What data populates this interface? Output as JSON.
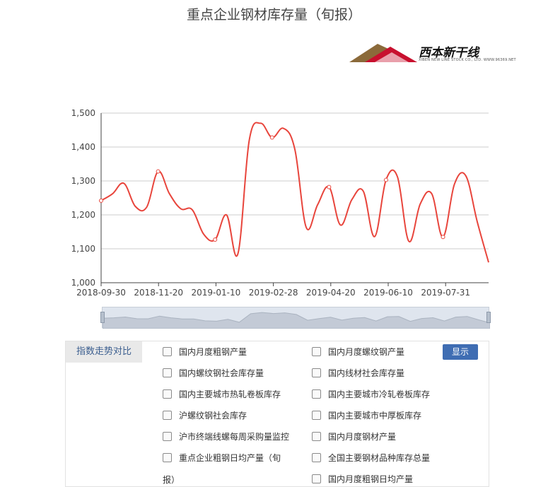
{
  "page_title": "重点企业钢材库存量（旬报）",
  "logo": {
    "name": "西本新干线",
    "subtitle": "XIBEN NEW LINE STOCK CO., LTD.  WWW.96369.NET"
  },
  "chart_data": {
    "type": "line",
    "title": "重点企业钢材库存量（旬报）",
    "xlabel": "",
    "ylabel": "",
    "ylim": [
      1000,
      1500
    ],
    "yticks": [
      1000,
      1100,
      1200,
      1300,
      1400,
      1500
    ],
    "ytick_labels": [
      "1,000",
      "1,100",
      "1,200",
      "1,300",
      "1,400",
      "1,500"
    ],
    "xtick_labels": [
      "2018-09-30",
      "2018-11-20",
      "2019-01-10",
      "2019-02-28",
      "2019-04-20",
      "2019-06-10",
      "2019-07-31"
    ],
    "grid": true,
    "color": "#e8453c",
    "series": [
      {
        "values": [
          1242,
          1262,
          1293,
          1225,
          1223,
          1328,
          1262,
          1218,
          1215,
          1143,
          1127,
          1200,
          1085,
          1420,
          1470,
          1428,
          1455,
          1393,
          1163,
          1230,
          1282,
          1170,
          1245,
          1270,
          1136,
          1303,
          1312,
          1122,
          1232,
          1263,
          1135,
          1290,
          1315,
          1180,
          1060
        ]
      }
    ]
  },
  "panel": {
    "tab_label": "指数走势对比",
    "button_label": "显示",
    "options_left": [
      "国内月度粗钢产量",
      "国内螺纹钢社会库存量",
      "国内主要城市热轧卷板库存",
      "沪螺纹钢社会库存",
      "沪市终端线螺每周采购量监控",
      "重点企业粗钢日均产量（旬"
    ],
    "option_left_wrap": "报）",
    "options_right": [
      "国内月度螺纹钢产量",
      "国内线材社会库存量",
      "国内主要城市冷轧卷板库存",
      "国内主要城市中厚板库存",
      "国内月度钢材产量",
      "全国主要钢材品种库存总量",
      "国内月度粗钢日均产量"
    ]
  }
}
